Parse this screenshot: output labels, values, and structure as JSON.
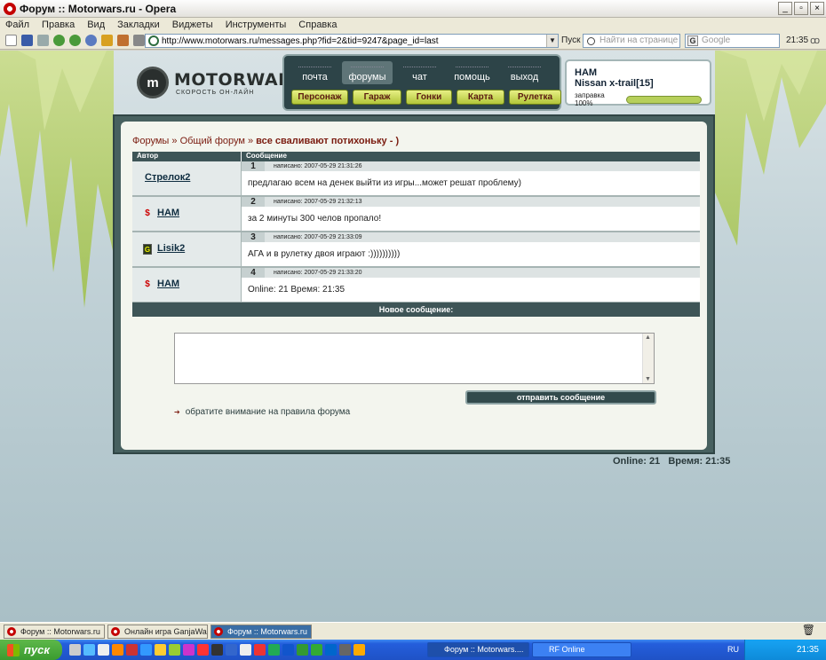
{
  "window": {
    "title": "Форум :: Motorwars.ru - Opera",
    "buttons": [
      "_",
      "▫",
      "×"
    ]
  },
  "menu": [
    "Файл",
    "Правка",
    "Вид",
    "Закладки",
    "Виджеты",
    "Инструменты",
    "Справка"
  ],
  "address": {
    "url": "http://www.motorwars.ru/messages.php?fid=2&tid=9247&page_id=last"
  },
  "toolbar": {
    "go_label": "Пуск",
    "find_placeholder": "Найти на странице",
    "search_placeholder": "Google",
    "clock": "21:35"
  },
  "site": {
    "logo_big": "MOTORWARS.RU",
    "logo_sub": "СКОРОСТЬ ОН-ЛАЙН",
    "logo_mark": "m",
    "nav_top": [
      "почта",
      "форумы",
      "чат",
      "помощь",
      "выход"
    ],
    "nav_active": "форумы",
    "nav_bottom": [
      "Персонаж",
      "Гараж",
      "Гонки",
      "Карта",
      "Рулетка"
    ],
    "user": {
      "name": "HAM",
      "car": "Nissan x-trail[15]",
      "fuel_label": "заправка 100%",
      "fuel": 1.0
    }
  },
  "forum": {
    "breadcrumb": [
      "Форумы",
      "Общий форум",
      "все сваливают потихоньку - )"
    ],
    "sep": " » ",
    "col_author": "Автор",
    "col_message": "Сообщение",
    "posts": [
      {
        "num": "1",
        "author": "Стрелок2",
        "icon": "",
        "date": "написано: 2007-05-29 21:31:26",
        "text": "предлагаю всем на денек выйти из игры...может решат проблему)"
      },
      {
        "num": "2",
        "author": "HAM",
        "icon": "$",
        "date": "написано: 2007-05-29 21:32:13",
        "text": "за 2 минуты 300 челов пропало!"
      },
      {
        "num": "3",
        "author": "Lisik2",
        "icon": "G",
        "date": "написано: 2007-05-29 21:33:09",
        "text": "АГА и в рулетку двоя играют :))))))))))"
      },
      {
        "num": "4",
        "author": "HAM",
        "icon": "$",
        "date": "написано: 2007-05-29 21:33:20",
        "text": "Online: 21 Время: 21:35"
      }
    ],
    "new_message": "Новое сообщение:",
    "send": "отправить сообщение",
    "rules": "обратите внимание на правила форума"
  },
  "status": {
    "online": "Online: 21",
    "time": "Время: 21:35"
  },
  "opera_tabs": [
    "Форум :: Motorwars.ru",
    "Онлайн игра GanjaWars...",
    "Форум :: Motorwars.ru"
  ],
  "taskbar": {
    "start": "пуск",
    "tasks": [
      "Форум :: Motorwars....",
      "RF Online"
    ],
    "lang": "RU",
    "clock": "21:35"
  }
}
